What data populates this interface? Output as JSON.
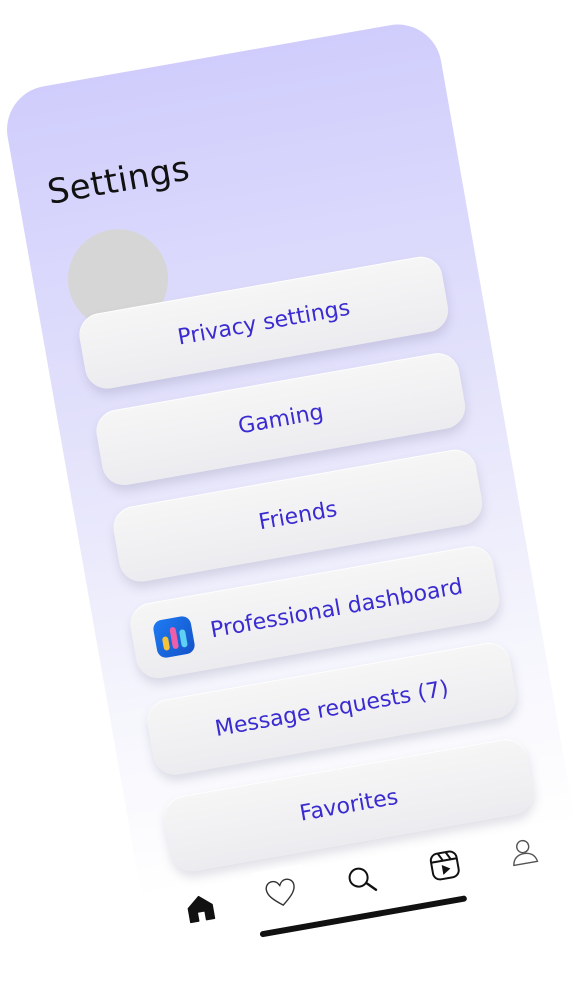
{
  "screen": {
    "title": "Settings"
  },
  "menu": {
    "items": [
      {
        "label": "Privacy settings"
      },
      {
        "label": "Gaming"
      },
      {
        "label": "Friends"
      },
      {
        "label": "Professional dashboard",
        "icon": "bar-chart-app-icon"
      },
      {
        "label": "Message requests (7)"
      },
      {
        "label": "Favorites"
      }
    ]
  },
  "tabbar": {
    "items": [
      {
        "icon": "home-icon"
      },
      {
        "icon": "heart-icon"
      },
      {
        "icon": "search-icon"
      },
      {
        "icon": "reels-icon"
      },
      {
        "icon": "profile-icon"
      }
    ]
  },
  "colors": {
    "accent_text": "#3a2bd1",
    "background_top": "#d0cdfc",
    "background_bottom": "#ffffff",
    "button_bg": "#f3f3f5"
  }
}
